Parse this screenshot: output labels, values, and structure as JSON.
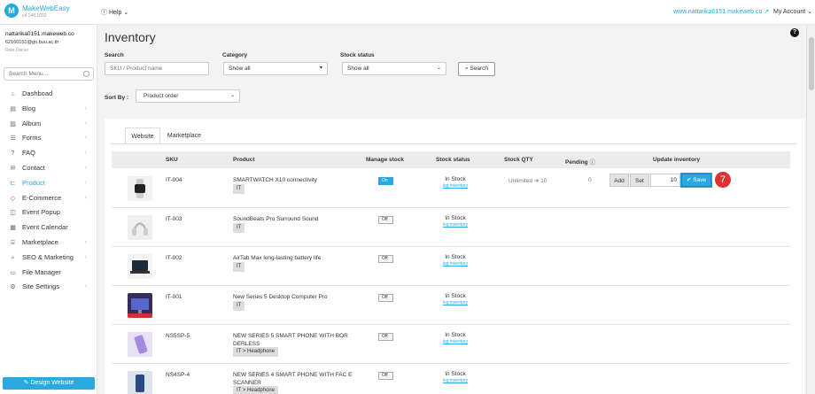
{
  "topbar": {
    "logo_letter": "M",
    "brand": "MakeWebEasy",
    "version": "v4.148.1652",
    "help": "Help",
    "site_link": "www.nattarika0151.makeweb.co",
    "my_account": "My Account"
  },
  "sidebar": {
    "user_name": "nattarika0151.makeweb.co",
    "user_email": "62160151@go.buu.ac.th",
    "user_role": "Role Owner",
    "search_placeholder": "Search Menu...",
    "items": [
      {
        "label": "Dashboad",
        "icon": "home-icon",
        "glyph": "⌂",
        "chevron": false
      },
      {
        "label": "Blog",
        "icon": "document-icon",
        "glyph": "▤",
        "chevron": true
      },
      {
        "label": "Album",
        "icon": "image-icon",
        "glyph": "▨",
        "chevron": true
      },
      {
        "label": "Forms",
        "icon": "form-icon",
        "glyph": "☰",
        "chevron": true
      },
      {
        "label": "FAQ",
        "icon": "faq-icon",
        "glyph": "?",
        "chevron": true
      },
      {
        "label": "Contact",
        "icon": "envelope-icon",
        "glyph": "✉",
        "chevron": true
      },
      {
        "label": "Product",
        "icon": "cart-icon",
        "glyph": "⊏",
        "chevron": true,
        "active": true
      },
      {
        "label": "E-Commerce",
        "icon": "tag-icon",
        "glyph": "◇",
        "chevron": true
      },
      {
        "label": "Event Popup",
        "icon": "popup-icon",
        "glyph": "◫",
        "chevron": false
      },
      {
        "label": "Event Calendar",
        "icon": "calendar-icon",
        "glyph": "▦",
        "chevron": false
      },
      {
        "label": "Marketplace",
        "icon": "shop-icon",
        "glyph": "⌸",
        "chevron": true
      },
      {
        "label": "SEO & Marketing",
        "icon": "search-icon",
        "glyph": "⌕",
        "chevron": true
      },
      {
        "label": "File Manager",
        "icon": "folder-icon",
        "glyph": "▭",
        "chevron": false
      },
      {
        "label": "Site Settings",
        "icon": "gear-icon",
        "glyph": "⚙",
        "chevron": true
      }
    ],
    "design_button": "Design Website"
  },
  "main": {
    "title": "Inventory",
    "filters": {
      "search_label": "Search",
      "search_placeholder": "SKU / Product name",
      "category_label": "Category",
      "category_value": "Show all",
      "stock_label": "Stock status",
      "stock_value": "Show all",
      "search_button": "Search"
    },
    "sort_label": "Sort By :",
    "sort_value": "Product order",
    "tabs": [
      "Website",
      "Marketplace"
    ],
    "columns": {
      "sku": "SKU",
      "product": "Product",
      "manage_stock": "Manage stock",
      "stock_status": "Stock status",
      "stock_qty": "Stock QTY",
      "pending": "Pending",
      "update_inventory": "Update inventory"
    },
    "rows": [
      {
        "sku": "IT-004",
        "name": "SMARTWATCH X10 connectivity",
        "tag": "IT",
        "manage": "On",
        "status": "In Stock",
        "log": "log inventory",
        "qty": "Unlimited ➔ 10",
        "pending": "0",
        "img": "smartwatch-image"
      },
      {
        "sku": "IT-003",
        "name": "SoundBeats Pro Surround Sound",
        "tag": "IT",
        "manage": "Off",
        "status": "In Stock",
        "log": "log inventory",
        "img": "headphone-image"
      },
      {
        "sku": "IT-002",
        "name": "AirTab Max long-lasting battery life",
        "tag": "IT",
        "manage": "Off",
        "status": "In Stock",
        "log": "log inventory",
        "img": "tablet-image"
      },
      {
        "sku": "IT-001",
        "name": "New Series 5 Desktop Computer Pro",
        "tag": "IT",
        "manage": "Off",
        "status": "In Stock",
        "log": "log inventory",
        "img": "desktop-image"
      },
      {
        "sku": "NS5SP-5",
        "name": "NEW SERIES 5 SMART PHONE WITH BOR DERLESS",
        "tag": "IT > Headphone",
        "manage": "Off",
        "status": "In Stock",
        "log": "log inventory",
        "img": "phone-image"
      },
      {
        "sku": "NS4SP-4",
        "name": "NEW SERIES 4 SMART PHONE WITH FAC E SCANNER",
        "tag": "IT > Headphone",
        "manage": "Off",
        "status": "In Stock",
        "log": "log inventory",
        "img": "phone-dark-image"
      }
    ],
    "update": {
      "add": "Add",
      "set": "Set",
      "value": "10",
      "save": "Save",
      "step_badge": "7"
    }
  }
}
